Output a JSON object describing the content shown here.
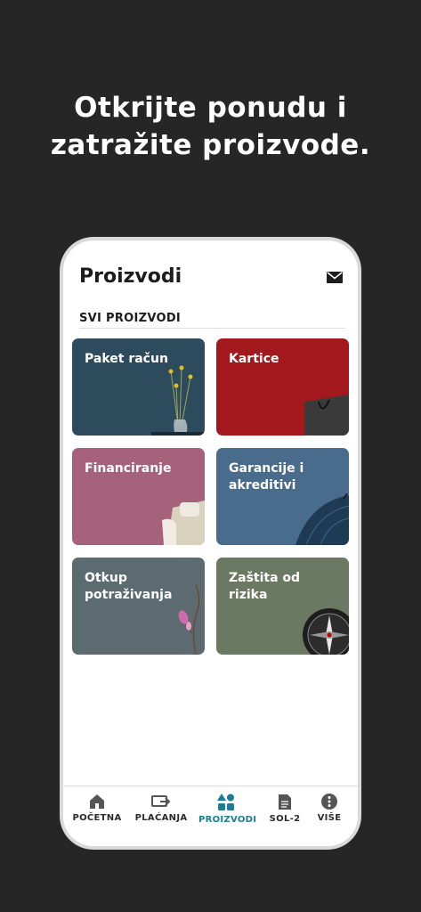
{
  "headline": {
    "line1": "Otkrijte ponudu i",
    "line2": "zatražite proizvode."
  },
  "header": {
    "title": "Proizvodi",
    "mail_icon": "envelope-icon"
  },
  "section": {
    "title": "SVI PROIZVODI"
  },
  "products": [
    {
      "label": "Paket račun",
      "color": "#2d4b5c"
    },
    {
      "label": "Kartice",
      "color": "#a3181c"
    },
    {
      "label": "Financiranje",
      "color": "#a6627a"
    },
    {
      "label": "Garancije i akreditivi",
      "color": "#4a6c8c"
    },
    {
      "label": "Otkup potraživanja",
      "color": "#5b6b70"
    },
    {
      "label": "Zaštita od rizika",
      "color": "#6c7962"
    }
  ],
  "nav": {
    "items": [
      {
        "label": "POČETNA",
        "icon": "home-icon"
      },
      {
        "label": "PLAĆANJA",
        "icon": "payments-icon"
      },
      {
        "label": "PROIZVODI",
        "icon": "products-icon",
        "active": true
      },
      {
        "label": "SOL-2",
        "icon": "document-icon"
      },
      {
        "label": "VIŠE",
        "icon": "more-icon"
      }
    ],
    "active_color": "#1a7d96"
  }
}
